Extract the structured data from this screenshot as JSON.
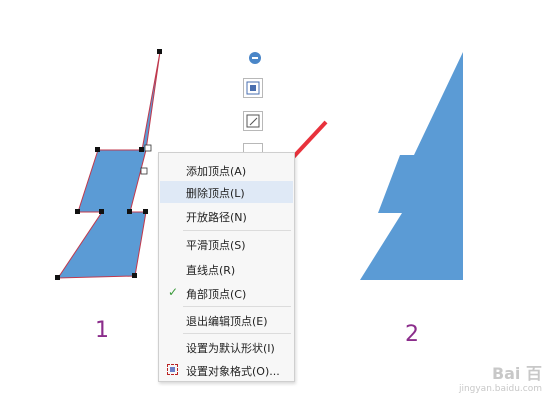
{
  "context_menu": {
    "items": [
      {
        "label": "添加顶点(A)"
      },
      {
        "label": "删除顶点(L)"
      },
      {
        "label": "开放路径(N)"
      },
      {
        "label": "平滑顶点(S)"
      },
      {
        "label": "直线点(R)"
      },
      {
        "label": "角部顶点(C)"
      },
      {
        "label": "退出编辑顶点(E)"
      },
      {
        "label": "设置为默认形状(I)"
      },
      {
        "label": "设置对象格式(O)..."
      }
    ],
    "highlighted": "删除顶点(L)",
    "checked": "角部顶点(C)"
  },
  "labels": {
    "left": "1",
    "right": "2"
  },
  "watermark": {
    "line1": "Bai 百",
    "line2": "jingyan.baidu.com"
  },
  "colors": {
    "shape_fill": "#5b9bd5",
    "highlight_ellipse": "#e8323c",
    "label_color": "#8b2c8b"
  },
  "icons": [
    "minus-icon",
    "layout-options-icon",
    "edit-shape-icon",
    "fill-icon",
    "check-icon",
    "format-object-icon"
  ]
}
